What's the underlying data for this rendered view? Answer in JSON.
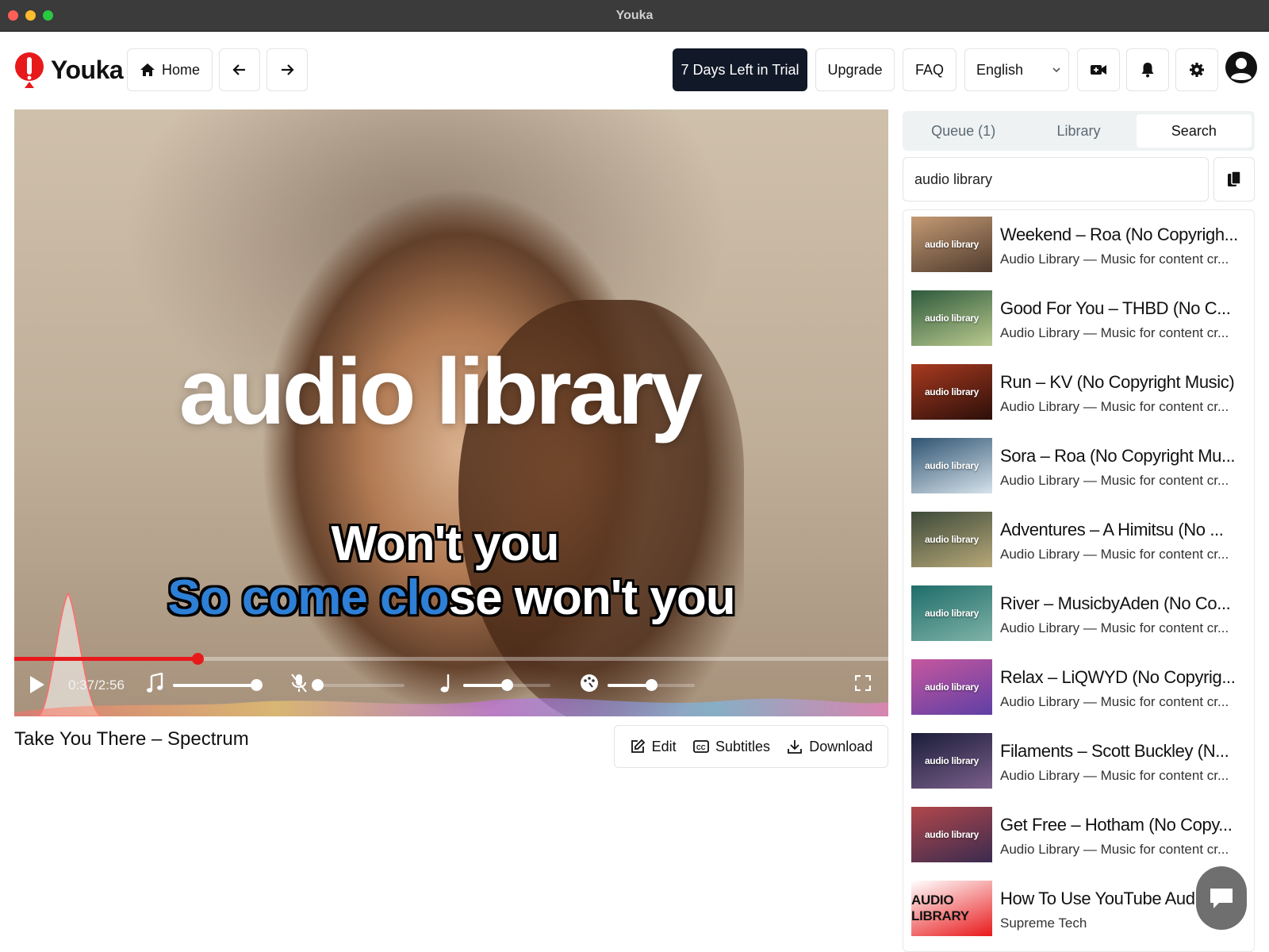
{
  "window": {
    "title": "Youka"
  },
  "header": {
    "app_name": "Youka",
    "home_label": "Home",
    "trial_label": "7 Days Left in Trial",
    "upgrade_label": "Upgrade",
    "faq_label": "FAQ",
    "language": "English"
  },
  "player": {
    "video_title": "audio library",
    "lyric_line1": "Won't you",
    "lyric_line2_sung": "So come clo",
    "lyric_line2_unsung": "se won't you",
    "time": "0:37/2:56",
    "progress": 0.21,
    "music_volume": 0.95,
    "mic_volume": 0.0,
    "pitch": 0.5,
    "tempo": 0.5,
    "accent_color": "#e8191b",
    "sung_color": "#2e7fd6"
  },
  "song": {
    "title": "Take You There – Spectrum",
    "edit_label": "Edit",
    "subtitles_label": "Subtitles",
    "download_label": "Download"
  },
  "sidebar": {
    "tabs": [
      "Queue (1)",
      "Library",
      "Search"
    ],
    "active_tab": "Search",
    "search_value": "audio library",
    "results": [
      {
        "title": "Weekend – Roa (No Copyrigh...",
        "subtitle": "Audio Library — Music for content cr...",
        "thumb_label": "audio library"
      },
      {
        "title": "Good For You – THBD (No C...",
        "subtitle": "Audio Library — Music for content cr...",
        "thumb_label": "audio library"
      },
      {
        "title": "Run – KV (No Copyright Music)",
        "subtitle": "Audio Library — Music for content cr...",
        "thumb_label": "audio library"
      },
      {
        "title": "Sora – Roa (No Copyright Mu...",
        "subtitle": "Audio Library — Music for content cr...",
        "thumb_label": "audio library"
      },
      {
        "title": "Adventures – A Himitsu (No ...",
        "subtitle": "Audio Library — Music for content cr...",
        "thumb_label": "audio library"
      },
      {
        "title": "River – MusicbyAden (No Co...",
        "subtitle": "Audio Library — Music for content cr...",
        "thumb_label": "audio library"
      },
      {
        "title": "Relax – LiQWYD (No Copyrig...",
        "subtitle": "Audio Library — Music for content cr...",
        "thumb_label": "audio library"
      },
      {
        "title": "Filaments – Scott Buckley (N...",
        "subtitle": "Audio Library — Music for content cr...",
        "thumb_label": "audio library"
      },
      {
        "title": "Get Free – Hotham (No Copy...",
        "subtitle": "Audio Library — Music for content cr...",
        "thumb_label": "audio library"
      },
      {
        "title": "How To Use YouTube Audio",
        "subtitle": "Supreme Tech",
        "thumb_label": "AUDIO LIBRARY"
      }
    ]
  }
}
